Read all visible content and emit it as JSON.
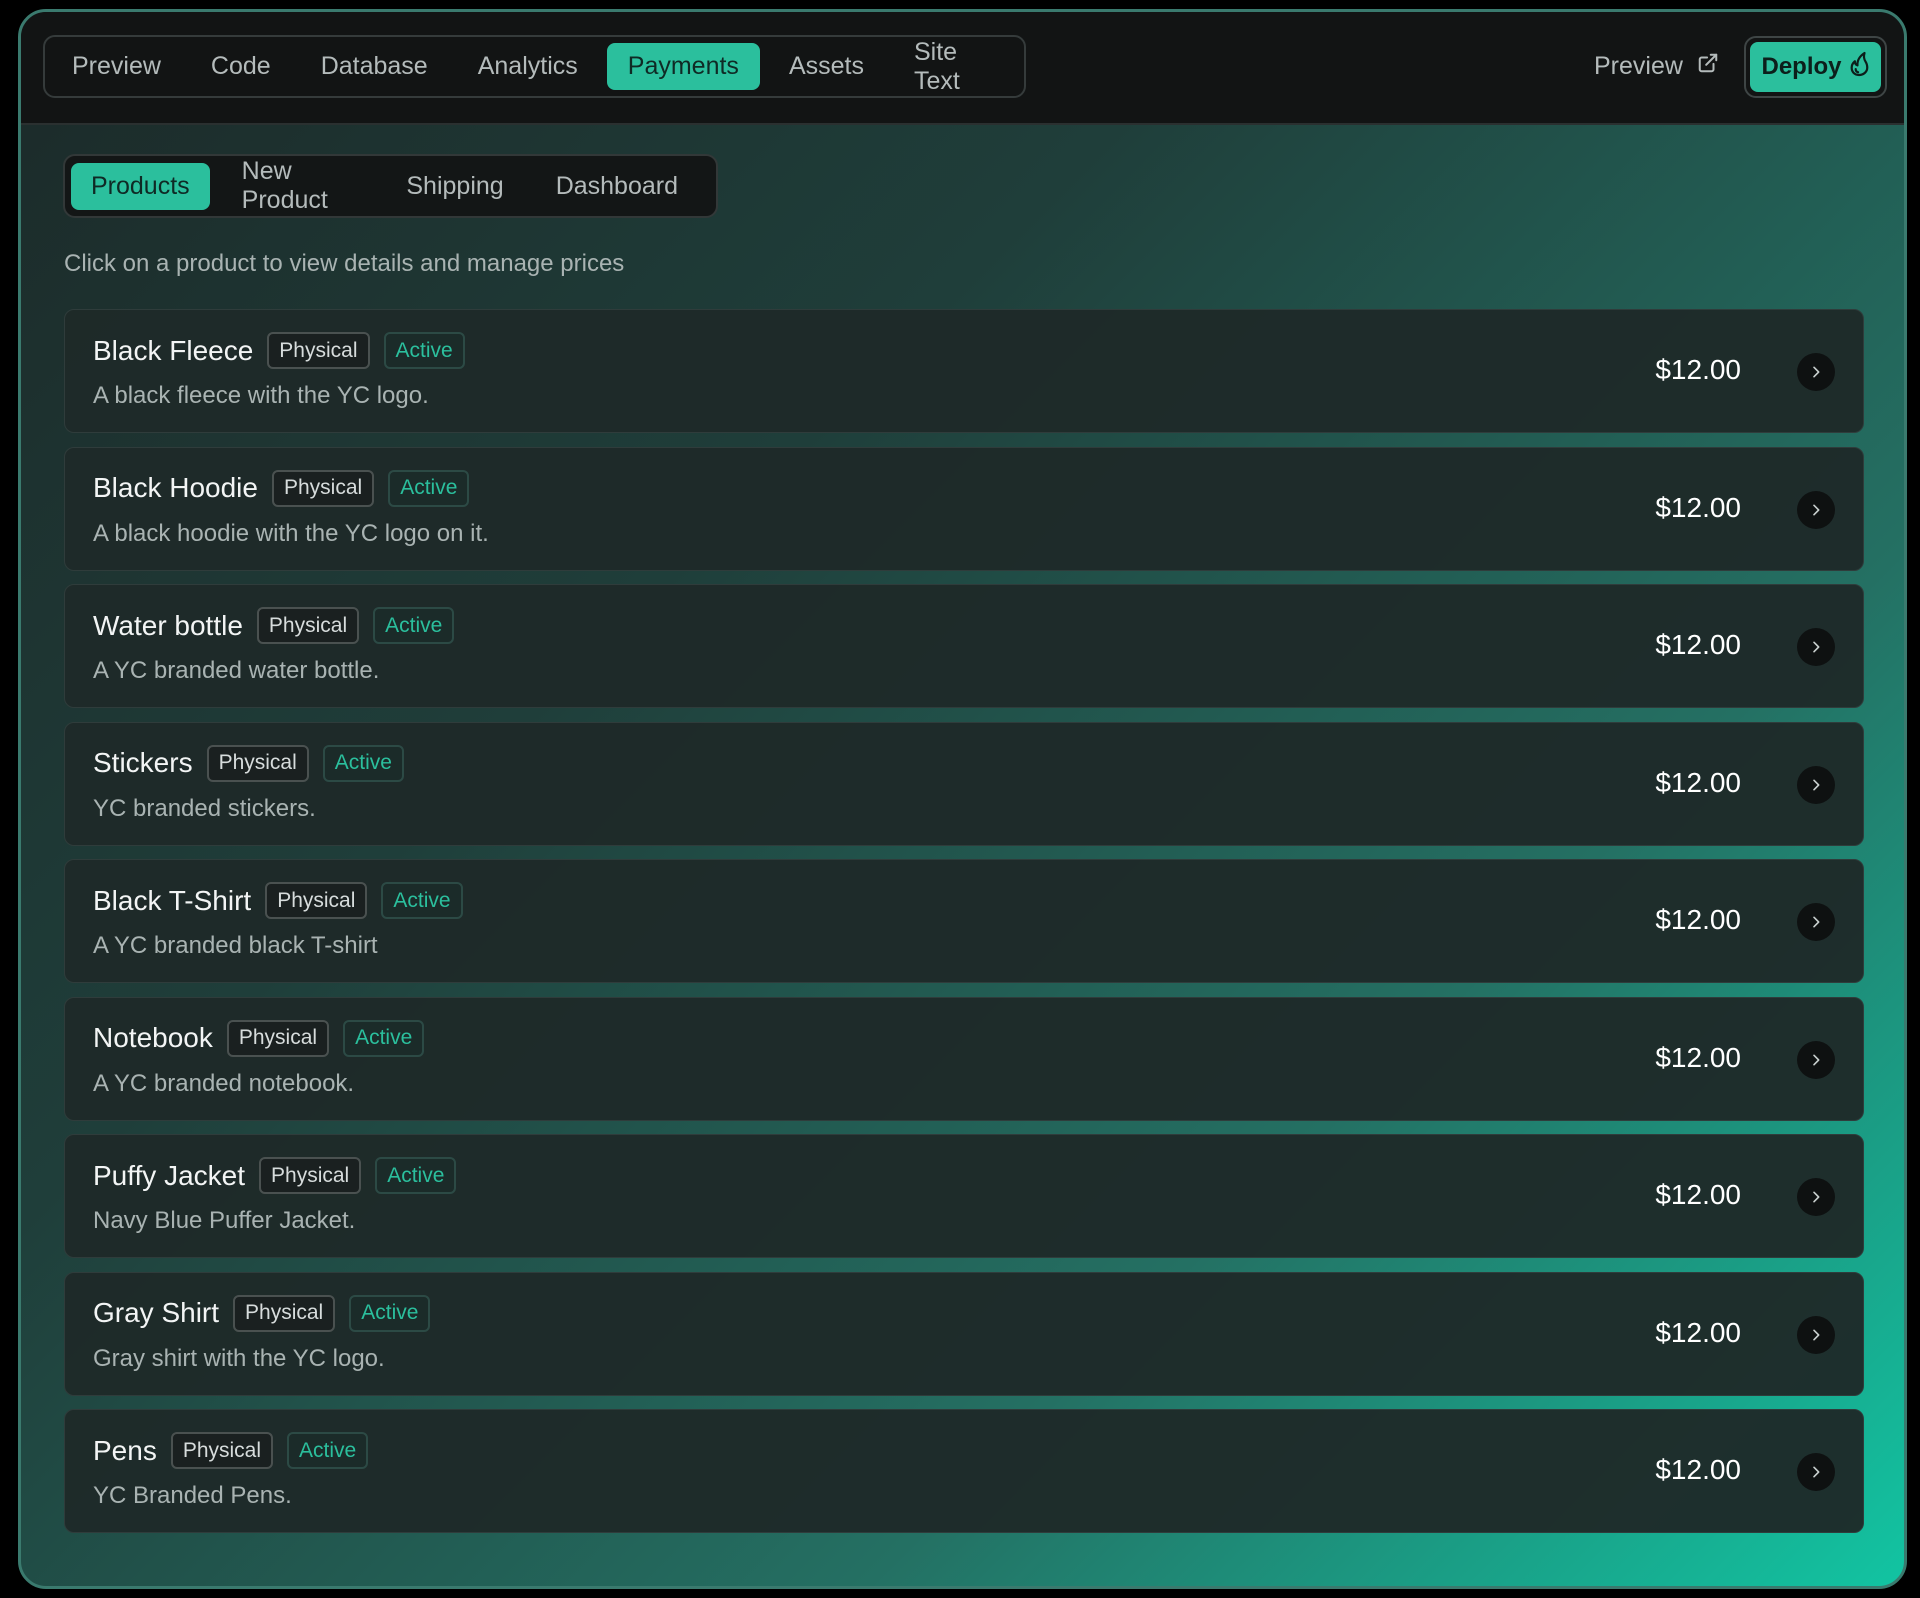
{
  "main_tabs": [
    {
      "label": "Preview",
      "active": false
    },
    {
      "label": "Code",
      "active": false
    },
    {
      "label": "Database",
      "active": false
    },
    {
      "label": "Analytics",
      "active": false
    },
    {
      "label": "Payments",
      "active": true
    },
    {
      "label": "Assets",
      "active": false
    },
    {
      "label": "Site Text",
      "active": false
    }
  ],
  "header": {
    "preview_label": "Preview",
    "preview_icon": "external-link-icon",
    "deploy_label": "Deploy",
    "deploy_icon": "flame-icon"
  },
  "sub_tabs": [
    {
      "label": "Products",
      "active": true
    },
    {
      "label": "New Product",
      "active": false
    },
    {
      "label": "Shipping",
      "active": false
    },
    {
      "label": "Dashboard",
      "active": false
    }
  ],
  "subtitle": "Click on a product to view details and manage prices",
  "products": [
    {
      "name": "Black Fleece",
      "type": "Physical",
      "status": "Active",
      "description": "A black fleece with the YC logo.",
      "price": "$12.00"
    },
    {
      "name": "Black Hoodie",
      "type": "Physical",
      "status": "Active",
      "description": "A black hoodie with the YC logo on it.",
      "price": "$12.00"
    },
    {
      "name": "Water bottle",
      "type": "Physical",
      "status": "Active",
      "description": "A YC branded water bottle.",
      "price": "$12.00"
    },
    {
      "name": "Stickers",
      "type": "Physical",
      "status": "Active",
      "description": "YC branded stickers.",
      "price": "$12.00"
    },
    {
      "name": "Black T-Shirt",
      "type": "Physical",
      "status": "Active",
      "description": "A YC branded black T-shirt",
      "price": "$12.00"
    },
    {
      "name": "Notebook",
      "type": "Physical",
      "status": "Active",
      "description": "A YC branded notebook.",
      "price": "$12.00"
    },
    {
      "name": "Puffy Jacket",
      "type": "Physical",
      "status": "Active",
      "description": "Navy Blue Puffer Jacket.",
      "price": "$12.00"
    },
    {
      "name": "Gray Shirt",
      "type": "Physical",
      "status": "Active",
      "description": "Gray shirt with the YC logo.",
      "price": "$12.00"
    },
    {
      "name": "Pens",
      "type": "Physical",
      "status": "Active",
      "description": "YC Branded Pens.",
      "price": "$12.00"
    }
  ],
  "colors": {
    "accent": "#2bbf9d",
    "topbar_bg": "#121414",
    "card_bg": "#1e2a29",
    "gradient_end": "#12c4a2"
  }
}
